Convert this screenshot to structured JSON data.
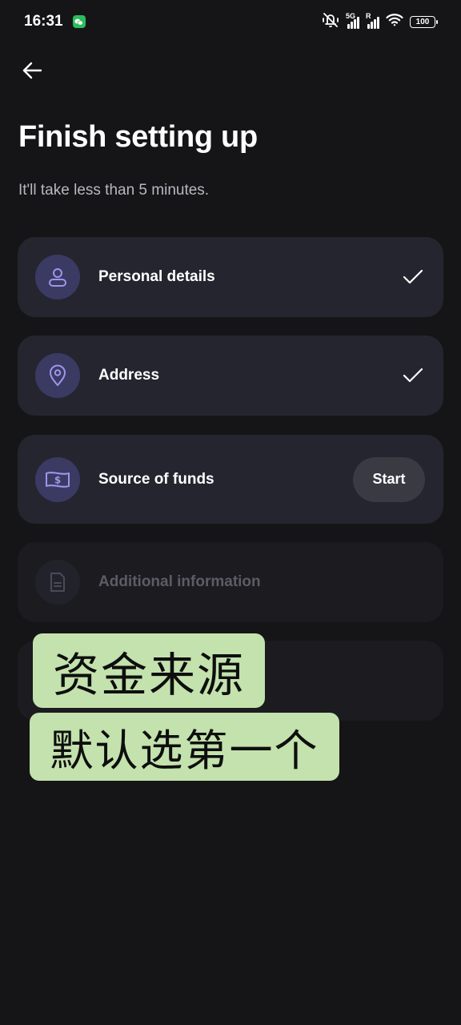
{
  "status_bar": {
    "time": "16:31",
    "net1_label": "5G",
    "net2_label": "R",
    "battery": "100"
  },
  "header": {
    "title": "Finish setting up",
    "subtitle": "It'll take less than 5 minutes."
  },
  "steps": [
    {
      "label": "Personal details",
      "icon": "person-icon",
      "status": "complete"
    },
    {
      "label": "Address",
      "icon": "location-pin-icon",
      "status": "complete"
    },
    {
      "label": "Source of funds",
      "icon": "banknote-icon",
      "status": "pending",
      "action_label": "Start"
    },
    {
      "label": "Additional information",
      "icon": "document-icon",
      "status": "locked"
    }
  ],
  "overlay": {
    "line1": "资金来源",
    "line2": "默认选第一个"
  },
  "colors": {
    "background": "#151517",
    "card": "#252530",
    "icon_circle": "#3b3a63",
    "icon_stroke": "#9d96ec",
    "sticker": "#c3e2ad"
  }
}
